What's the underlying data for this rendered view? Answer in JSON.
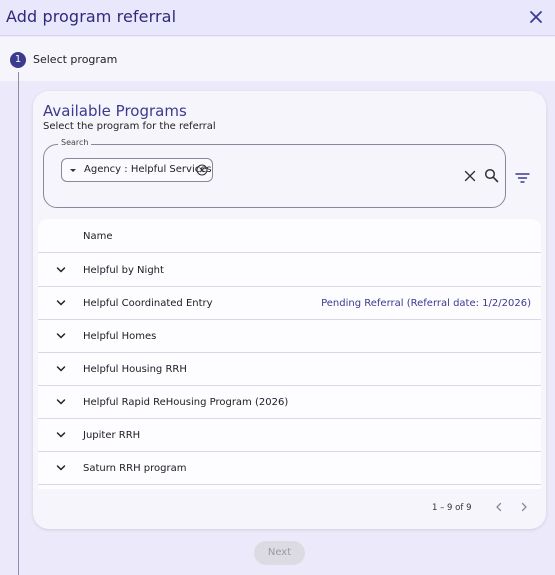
{
  "dialog": {
    "title": "Add program referral",
    "close_icon": "close-icon"
  },
  "stepper": {
    "step_number": "1",
    "step_label": "Select program"
  },
  "programs": {
    "title": "Available Programs",
    "subtitle": "Select the program for the referral",
    "search": {
      "legend": "Search",
      "chip_text": "Agency :  Helpful Services",
      "icons": [
        "chevron-down-icon",
        "remove-chip-icon",
        "clear-icon",
        "search-icon",
        "filter-icon"
      ]
    },
    "table": {
      "column_name": "Name",
      "rows": [
        {
          "name": "Helpful by Night",
          "status": ""
        },
        {
          "name": "Helpful Coordinated Entry",
          "status": "Pending Referral (Referral date: 1/2/2026)"
        },
        {
          "name": "Helpful Homes",
          "status": ""
        },
        {
          "name": "Helpful Housing RRH",
          "status": ""
        },
        {
          "name": "Helpful Rapid ReHousing Program (2026)",
          "status": ""
        },
        {
          "name": "Jupiter RRH",
          "status": ""
        },
        {
          "name": "Saturn RRH program",
          "status": ""
        }
      ]
    },
    "pagination": {
      "range": "1 – 9 of 9"
    }
  },
  "actions": {
    "next_label": "Next"
  },
  "colors": {
    "accent": "#3b3a8f",
    "background": "#eceafa",
    "card": "#f7f5fc"
  }
}
